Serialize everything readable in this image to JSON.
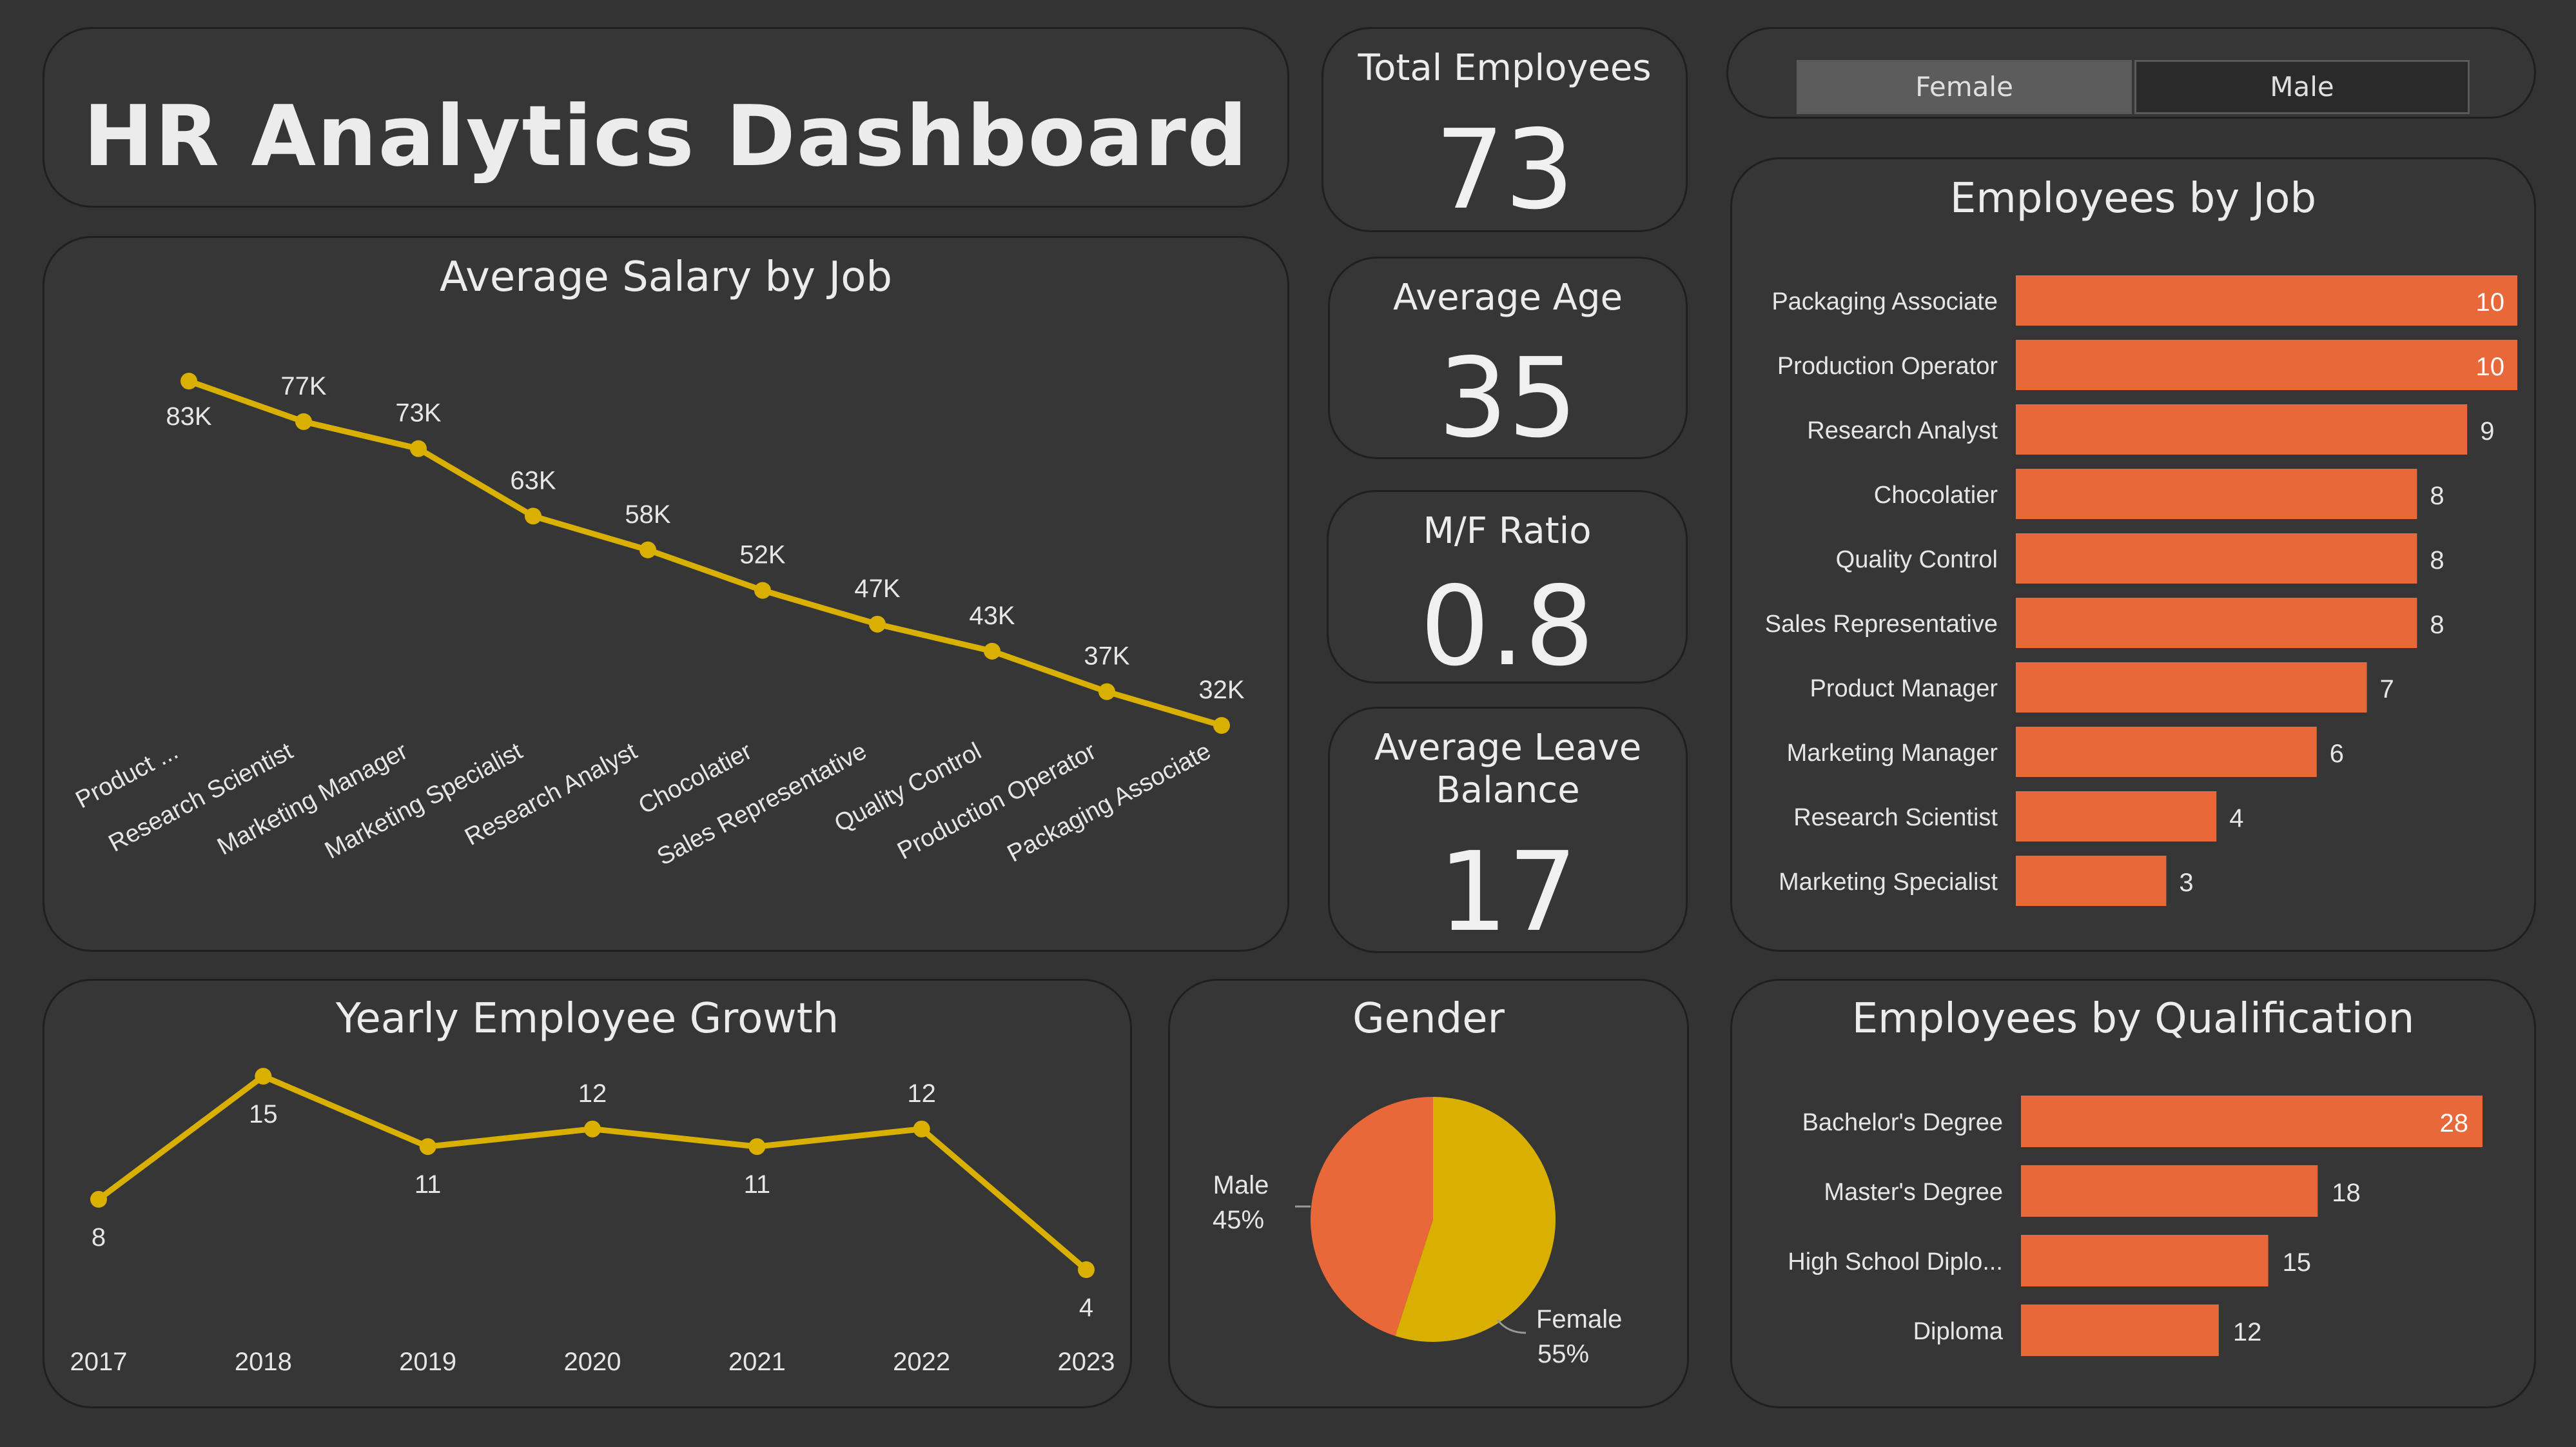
{
  "header": {
    "title": "HR Analytics Dashboard"
  },
  "kpis": {
    "total_employees": {
      "label": "Total Employees",
      "value": "73"
    },
    "average_age": {
      "label": "Average Age",
      "value": "35"
    },
    "mf_ratio": {
      "label": "M/F Ratio",
      "value": "0.8"
    },
    "average_leave": {
      "label_line1": "Average Leave",
      "label_line2": "Balance",
      "value": "17"
    }
  },
  "slicer": {
    "options": [
      "Female",
      "Male"
    ],
    "selected": "Female"
  },
  "colors": {
    "line": "#d9b000",
    "bar": "#e8683a",
    "female": "#d9b000",
    "male": "#e8683a",
    "background": "#333333"
  },
  "chart_data": [
    {
      "id": "salary",
      "type": "line",
      "title": "Average Salary by Job",
      "categories": [
        "Product ...",
        "Research Scientist",
        "Marketing Manager",
        "Marketing Specialist",
        "Research Analyst",
        "Chocolatier",
        "Sales Representative",
        "Quality Control",
        "Production Operator",
        "Packaging Associate"
      ],
      "values": [
        83000,
        77000,
        73000,
        63000,
        58000,
        52000,
        47000,
        43000,
        37000,
        32000
      ],
      "labels": [
        "83K",
        "77K",
        "73K",
        "63K",
        "58K",
        "52K",
        "47K",
        "43K",
        "37K",
        "32K"
      ]
    },
    {
      "id": "job",
      "type": "bar",
      "title": "Employees by Job",
      "categories": [
        "Packaging Associate",
        "Production Operator",
        "Research Analyst",
        "Chocolatier",
        "Quality Control",
        "Sales Representative",
        "Product Manager",
        "Marketing Manager",
        "Research Scientist",
        "Marketing Specialist"
      ],
      "values": [
        10,
        10,
        9,
        8,
        8,
        8,
        7,
        6,
        4,
        3
      ]
    },
    {
      "id": "growth",
      "type": "line",
      "title": "Yearly Employee Growth",
      "categories": [
        "2017",
        "2018",
        "2019",
        "2020",
        "2021",
        "2022",
        "2023"
      ],
      "values": [
        8,
        15,
        11,
        12,
        11,
        12,
        4
      ]
    },
    {
      "id": "gender",
      "type": "pie",
      "title": "Gender",
      "slices": [
        {
          "name": "Female",
          "value": 55,
          "label": "55%"
        },
        {
          "name": "Male",
          "value": 45,
          "label": "45%"
        }
      ]
    },
    {
      "id": "qual",
      "type": "bar",
      "title": "Employees by Qualification",
      "categories": [
        "Bachelor's Degree",
        "Master's Degree",
        "High School Diplo...",
        "Diploma"
      ],
      "values": [
        28,
        18,
        15,
        12
      ]
    }
  ]
}
